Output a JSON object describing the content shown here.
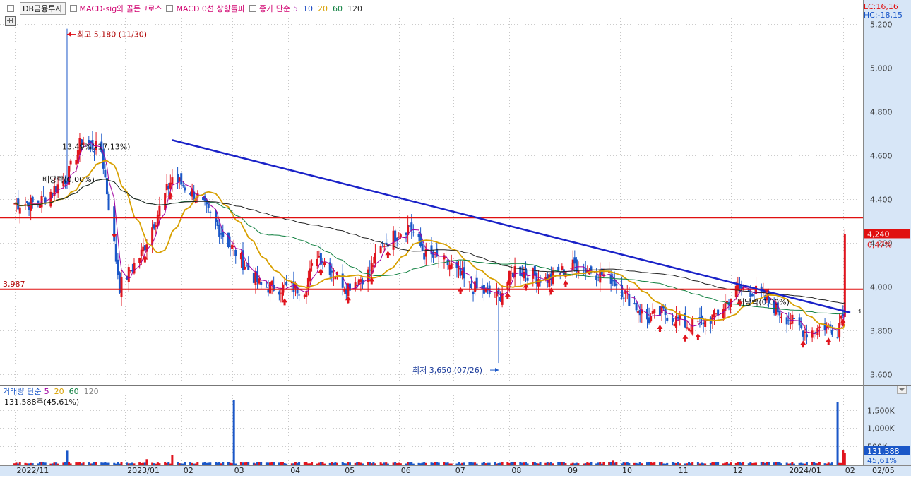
{
  "header": {
    "stock_name": "DB금융투자",
    "indicators": [
      {
        "text": "MACD-sig와 골든크로스",
        "color": "#d0006f"
      },
      {
        "text": "MACD 0선 상향돌파",
        "color": "#d0006f"
      }
    ],
    "ma_label": "종가 단순",
    "ma_periods": [
      {
        "text": "5",
        "color": "#a000a0"
      },
      {
        "text": "10",
        "color": "#1040c0"
      },
      {
        "text": "20",
        "color": "#d8a000"
      },
      {
        "text": "60",
        "color": "#108040"
      },
      {
        "text": "120",
        "color": "#222222"
      }
    ]
  },
  "lc_label": "LC:16,16",
  "hc_label": "HC:-18,15",
  "volume_header": {
    "label": "거래량",
    "ma_label": "단순",
    "ma_periods": [
      {
        "text": "5",
        "color": "#a000a0"
      },
      {
        "text": "20",
        "color": "#d8a000"
      },
      {
        "text": "60",
        "color": "#108040"
      },
      {
        "text": "120",
        "color": "#888888"
      }
    ],
    "current_volume": "131,588주(45,61%)"
  },
  "annotations": {
    "high": "최고 5,180 (11/30)",
    "low": "최저 3,650 (07/26)",
    "drop_pct": "13,49%(-17,13%)",
    "dividend_1": "배당락(0,00%)",
    "dividend_2": "배당락(0,00%)",
    "support_label": "3,987",
    "right_edge_label": "3"
  },
  "price_box": {
    "value": "4,240",
    "change": "0,47%"
  },
  "volume_box": {
    "value": "131,588",
    "pct": "45,61%"
  },
  "colors": {
    "up": "#e0141e",
    "down": "#1a57c8",
    "trendline": "#1a22c8",
    "hline": "#e01010",
    "ma5": "#a000a0",
    "ma10": "#1040c0",
    "ma20": "#d8a000",
    "ma60": "#108040",
    "ma120": "#222222",
    "axis_panel": "#d7e6f7"
  },
  "chart_data": {
    "type": "candlestick",
    "price_axis": {
      "ticks": [
        3600,
        3800,
        4000,
        4200,
        4400,
        4600,
        4800,
        5000,
        5200
      ],
      "range": [
        3550,
        5240
      ]
    },
    "volume_axis": {
      "ticks": [
        500000,
        1000000,
        1500000
      ],
      "tick_labels": [
        "500K",
        "1,000K",
        "1,500K"
      ],
      "range": [
        0,
        1900000
      ]
    },
    "x_tick_labels": [
      "2022/11",
      "2023/01",
      "02",
      "03",
      "04",
      "05",
      "06",
      "07",
      "08",
      "09",
      "10",
      "11",
      "12",
      "2024/01",
      "02",
      "02/05"
    ],
    "horizontal_lines": [
      4315,
      3987
    ],
    "trendline": {
      "from": {
        "date": "2023/01/27",
        "value": 4670
      },
      "to": {
        "date": "2024/02/05",
        "value": 3880
      }
    },
    "last_close": 4240,
    "high": {
      "date": "2022/11/30",
      "value": 5180
    },
    "low": {
      "date": "2023/07/26",
      "value": 3650
    },
    "anchors": [
      {
        "date": "2022/11/14",
        "value": 4380
      },
      {
        "date": "2022/11/30",
        "value": 4500
      },
      {
        "date": "2022/12/08",
        "value": 4670
      },
      {
        "date": "2022/12/19",
        "value": 4620
      },
      {
        "date": "2022/12/29",
        "value": 4000
      },
      {
        "date": "2023/01/10",
        "value": 4150
      },
      {
        "date": "2023/01/27",
        "value": 4500
      },
      {
        "date": "2023/02/09",
        "value": 4420
      },
      {
        "date": "2023/02/27",
        "value": 4200
      },
      {
        "date": "2023/03/17",
        "value": 4000
      },
      {
        "date": "2023/04/10",
        "value": 3990
      },
      {
        "date": "2023/04/17",
        "value": 4150
      },
      {
        "date": "2023/05/03",
        "value": 4000
      },
      {
        "date": "2023/05/15",
        "value": 4060
      },
      {
        "date": "2023/05/24",
        "value": 4200
      },
      {
        "date": "2023/06/07",
        "value": 4280
      },
      {
        "date": "2023/06/15",
        "value": 4150
      },
      {
        "date": "2023/06/29",
        "value": 4100
      },
      {
        "date": "2023/07/10",
        "value": 4000
      },
      {
        "date": "2023/07/26",
        "value": 3950
      },
      {
        "date": "2023/08/04",
        "value": 4080
      },
      {
        "date": "2023/08/21",
        "value": 4030
      },
      {
        "date": "2023/09/06",
        "value": 4100
      },
      {
        "date": "2023/09/26",
        "value": 4040
      },
      {
        "date": "2023/10/16",
        "value": 3850
      },
      {
        "date": "2023/10/25",
        "value": 3880
      },
      {
        "date": "2023/11/08",
        "value": 3820
      },
      {
        "date": "2023/11/22",
        "value": 3860
      },
      {
        "date": "2023/12/05",
        "value": 3990
      },
      {
        "date": "2023/12/14",
        "value": 3980
      },
      {
        "date": "2023/12/26",
        "value": 3900
      },
      {
        "date": "2024/01/05",
        "value": 3830
      },
      {
        "date": "2024/01/12",
        "value": 3790
      },
      {
        "date": "2024/01/22",
        "value": 3820
      },
      {
        "date": "2024/01/29",
        "value": 3800
      },
      {
        "date": "2024/02/01",
        "value": 3900
      },
      {
        "date": "2024/02/02",
        "value": 4240
      }
    ]
  }
}
